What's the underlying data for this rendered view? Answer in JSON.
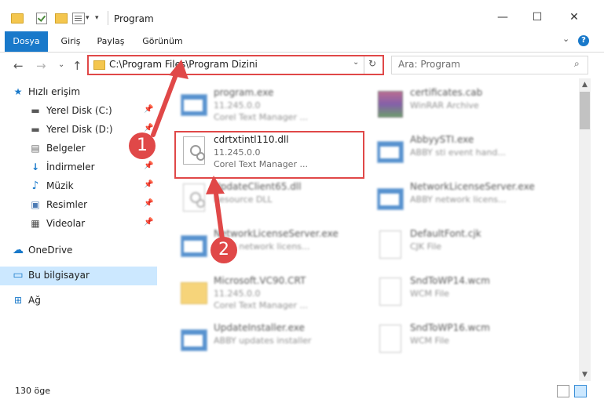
{
  "window": {
    "title": "Program",
    "minimize_glyph": "—",
    "maximize_glyph": "☐",
    "close_glyph": "✕"
  },
  "ribbon": {
    "tabs": [
      {
        "label": "Dosya",
        "active": true
      },
      {
        "label": "Giriş",
        "active": false
      },
      {
        "label": "Paylaş",
        "active": false
      },
      {
        "label": "Görünüm",
        "active": false
      }
    ],
    "expand_glyph": "⌄",
    "help_glyph": "?"
  },
  "navigation": {
    "back_glyph": "←",
    "forward_glyph": "→",
    "recent_glyph": "⌄",
    "up_glyph": "↑",
    "address": "C:\\Program Files\\Program Dizini",
    "address_dropdown_glyph": "⌄",
    "refresh_glyph": "↻",
    "search_placeholder": "Ara: Program"
  },
  "sidebar": {
    "items": [
      {
        "label": "Hızlı erişim",
        "icon": "star-icon",
        "glyph": "★",
        "color": "#1979ca",
        "pinned": false
      },
      {
        "label": "Yerel Disk (C:)",
        "icon": "drive-icon",
        "glyph": "▬",
        "color": "#5a5a5a",
        "pinned": true
      },
      {
        "label": "Yerel Disk (D:)",
        "icon": "drive-icon",
        "glyph": "▬",
        "color": "#5a5a5a",
        "pinned": true
      },
      {
        "label": "Belgeler",
        "icon": "documents-icon",
        "glyph": "▤",
        "color": "#6d6d6d",
        "pinned": true
      },
      {
        "label": "İndirmeler",
        "icon": "download-icon",
        "glyph": "↓",
        "color": "#1979ca",
        "pinned": true
      },
      {
        "label": "Müzik",
        "icon": "music-icon",
        "glyph": "♪",
        "color": "#1979ca",
        "pinned": true
      },
      {
        "label": "Resimler",
        "icon": "pictures-icon",
        "glyph": "▣",
        "color": "#4c7bb5",
        "pinned": true
      },
      {
        "label": "Videolar",
        "icon": "video-icon",
        "glyph": "▦",
        "color": "#4b4b4b",
        "pinned": true
      },
      {
        "label": "OneDrive",
        "icon": "cloud-icon",
        "glyph": "☁",
        "color": "#1979ca",
        "pinned": false
      },
      {
        "label": "Bu bilgisayar",
        "icon": "computer-icon",
        "glyph": "▭",
        "color": "#1979ca",
        "pinned": false,
        "selected": true
      },
      {
        "label": "Ağ",
        "icon": "network-icon",
        "glyph": "⊞",
        "color": "#1979ca",
        "pinned": false
      }
    ],
    "pin_glyph": "📌"
  },
  "files": {
    "left_column": [
      {
        "name": "program.exe",
        "line1": "11.245.0.0",
        "line2": "Corel Text Manager ...",
        "icon": "application-icon",
        "blurred": true
      },
      {
        "name": "cdrtxtintl110.dll",
        "line1": "11.245.0.0",
        "line2": "Corel Text Manager ...",
        "icon": "dll-gear-icon",
        "blurred": false
      },
      {
        "name": "UpdateClient65.dll",
        "line1": "Resource DLL",
        "line2": "",
        "icon": "dll-gear-icon",
        "blurred": true
      },
      {
        "name": "NetworkLicenseServer.exe",
        "line1": "ABBY network licens...",
        "line2": "",
        "icon": "application-icon",
        "blurred": true
      },
      {
        "name": "Microsoft.VC90.CRT",
        "line1": "11.245.0.0",
        "line2": "Corel Text Manager ...",
        "icon": "folder-icon",
        "blurred": true
      },
      {
        "name": "UpdateInstaller.exe",
        "line1": "ABBY updates installer",
        "line2": "",
        "icon": "application-icon",
        "blurred": true
      }
    ],
    "right_column": [
      {
        "name": "certificates.cab",
        "line1": "WinRAR Archive",
        "line2": "",
        "icon": "archive-icon",
        "blurred": true
      },
      {
        "name": "AbbyySTI.exe",
        "line1": "ABBY sti event hand...",
        "line2": "",
        "icon": "application-icon",
        "blurred": true
      },
      {
        "name": "NetworkLicenseServer.exe",
        "line1": "ABBY network licens...",
        "line2": "",
        "icon": "application-icon",
        "blurred": true
      },
      {
        "name": "DefaultFont.cjk",
        "line1": "CJK File",
        "line2": "",
        "icon": "file-icon",
        "blurred": true
      },
      {
        "name": "SndToWP14.wcm",
        "line1": "WCM File",
        "line2": "",
        "icon": "file-icon",
        "blurred": true
      },
      {
        "name": "SndToWP16.wcm",
        "line1": "WCM File",
        "line2": "",
        "icon": "file-icon",
        "blurred": true
      }
    ]
  },
  "annotations": {
    "marker_1": "1",
    "marker_2": "2",
    "accent_color": "#e04848"
  },
  "status": {
    "item_count": "130 öge"
  }
}
